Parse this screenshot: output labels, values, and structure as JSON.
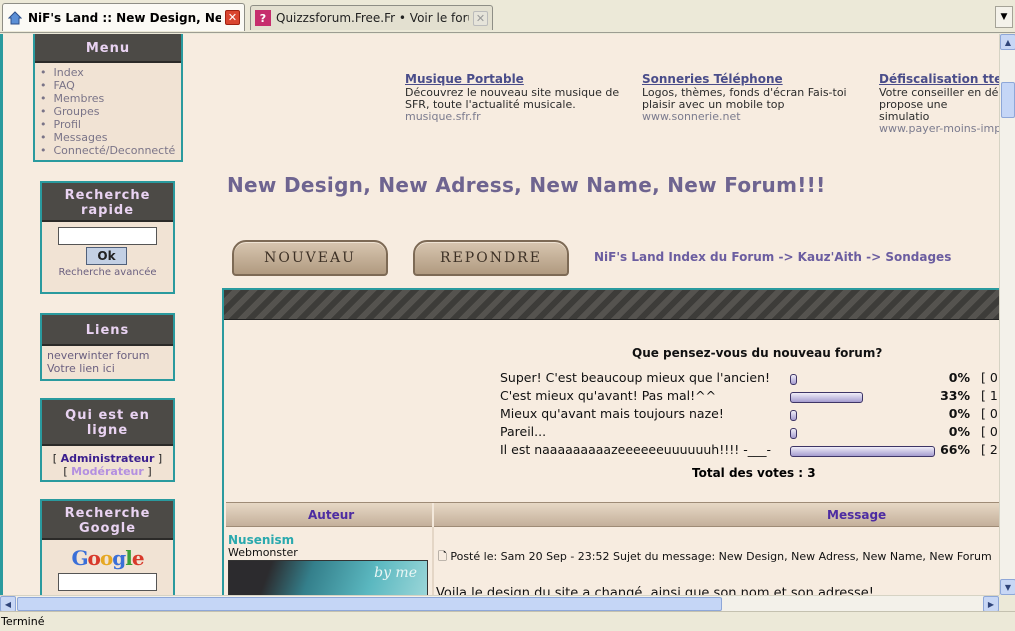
{
  "tabs": [
    {
      "title": "NiF's Land :: New Design, New A...",
      "active": true
    },
    {
      "title": "Quizzsforum.Free.Fr • Voir le forum - Indi...",
      "active": false
    }
  ],
  "status": "Terminé",
  "sidebar": {
    "menu": {
      "title": "Menu",
      "items": [
        "Index",
        "FAQ",
        "Membres",
        "Groupes",
        "Profil",
        "Messages",
        "Connecté/Deconnecté"
      ]
    },
    "search": {
      "title": "Recherche rapide",
      "button": "Ok",
      "advanced": "Recherche avancée"
    },
    "links": {
      "title": "Liens",
      "items": [
        "neverwinter forum",
        "Votre lien ici"
      ]
    },
    "online": {
      "title": "Qui est en ligne",
      "admin": "Administrateur",
      "mod": "Modérateur"
    },
    "google": {
      "title": "Recherche Google",
      "logo": "Google"
    }
  },
  "ads": [
    {
      "title": "Musique Portable",
      "text": "Découvrez le nouveau site musique de SFR, toute l'actualité musicale.",
      "url": "musique.sfr.fr"
    },
    {
      "title": "Sonneries Téléphone",
      "text": "Logos, thèmes, fonds d'écran Fais-toi plaisir avec un mobile top",
      "url": "www.sonnerie.net"
    },
    {
      "title": "Défiscalisation ttes",
      "text": "Votre conseiller en dé propose une simulatio",
      "url": "www.payer-moins-imp"
    }
  ],
  "page_title": "New Design, New Adress, New Name, New Forum!!!",
  "buttons": {
    "new": "NOUVEAU",
    "reply": "REPONDRE"
  },
  "breadcrumb": "NiF's Land Index du Forum -> Kauz'Aith -> Sondages",
  "poll": {
    "question": "Que pensez-vous du nouveau forum?",
    "options": [
      {
        "label": "Super! C'est beaucoup mieux que l'ancien!",
        "pct": "0%",
        "count": "[ 0",
        "fraction": 0
      },
      {
        "label": "C'est mieux qu'avant! Pas mal!^^",
        "pct": "33%",
        "count": "[ 1",
        "fraction": 0.33
      },
      {
        "label": "Mieux qu'avant mais toujours naze!",
        "pct": "0%",
        "count": "[ 0",
        "fraction": 0
      },
      {
        "label": "Pareil...",
        "pct": "0%",
        "count": "[ 0",
        "fraction": 0
      },
      {
        "label": "Il est naaaaaaaaazeeeeeeuuuuuuh!!!! -___-",
        "pct": "66%",
        "count": "[ 2",
        "fraction": 0.66
      }
    ],
    "total": "Total des votes : 3"
  },
  "table": {
    "author_header": "Auteur",
    "message_header": "Message"
  },
  "post": {
    "author": "Nusenism",
    "rank": "Webmonster",
    "avatar_text": "by me",
    "meta": "Posté le: Sam 20 Sep - 23:52     Sujet du message: New Design, New Adress, New Name, New Forum",
    "body": "Voila le design du site a changé, ainsi que son nom et son adresse!"
  }
}
